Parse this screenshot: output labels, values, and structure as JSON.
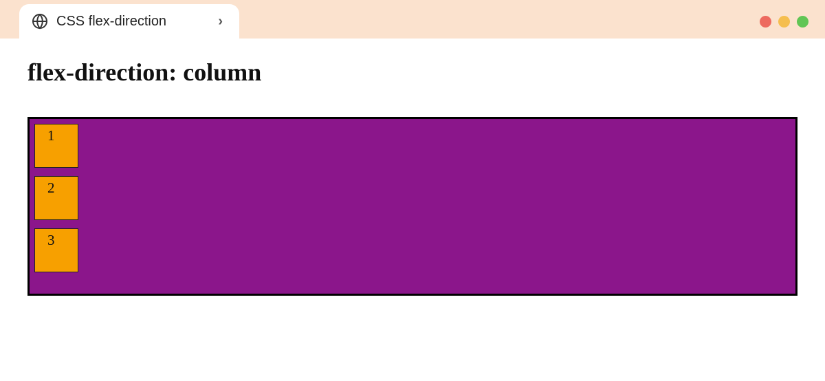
{
  "tab": {
    "title": "CSS flex-direction"
  },
  "heading": "flex-direction: column",
  "items": [
    "1",
    "2",
    "3"
  ]
}
